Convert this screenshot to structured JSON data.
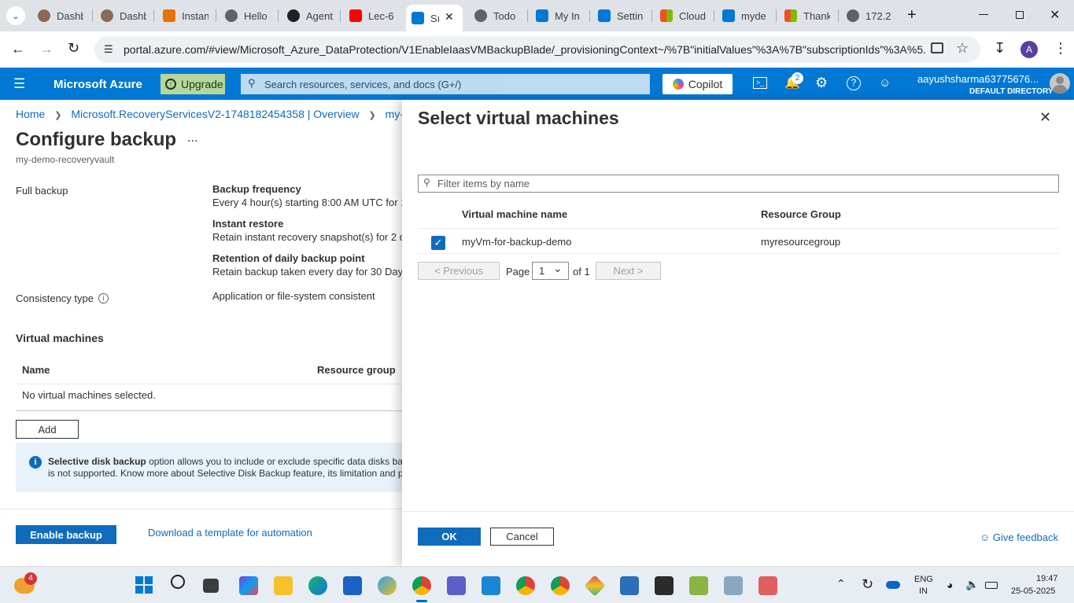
{
  "browser": {
    "tabs": [
      {
        "label": "Dashb",
        "favicon_color": "#8a6a55"
      },
      {
        "label": "Dashb",
        "favicon_color": "#8a6a55"
      },
      {
        "label": "Instan",
        "favicon_color": "#e8710a"
      },
      {
        "label": "Hello",
        "favicon_color": "#5f6368"
      },
      {
        "label": "Agent",
        "favicon_color": "#202124"
      },
      {
        "label": "Lec-6",
        "favicon_color": "#ff0000"
      },
      {
        "label": "Sı",
        "favicon_color": "#0078d4"
      },
      {
        "label": "Todo",
        "favicon_color": "#5f6368"
      },
      {
        "label": "My In",
        "favicon_color": "#0078d4"
      },
      {
        "label": "Settin",
        "favicon_color": "#0078d4"
      },
      {
        "label": "Cloud",
        "favicon_color": "#f25022"
      },
      {
        "label": "myde",
        "favicon_color": "#0078d4"
      },
      {
        "label": "Thank",
        "favicon_color": "#f25022"
      },
      {
        "label": "172.2",
        "favicon_color": "#5f6368"
      }
    ],
    "url": "portal.azure.com/#view/Microsoft_Azure_DataProtection/V1EnableIaasVMBackupBlade/_provisioningContext~/%7B\"initialValues\"%3A%7B\"subscriptionIds\"%3A%5...",
    "profile_initial": "A"
  },
  "azure": {
    "brand": "Microsoft Azure",
    "upgrade_label": "Upgrade",
    "search_placeholder": "Search resources, services, and docs (G+/)",
    "copilot_label": "Copilot",
    "notification_count": "2",
    "user_name": "aayushsharma63775676...",
    "directory": "DEFAULT DIRECTORY",
    "accent": "#0078d4"
  },
  "breadcrumb": {
    "home": "Home",
    "vault": "Microsoft.RecoveryServicesV2-1748182454358 | Overview",
    "current": "my-demo"
  },
  "config": {
    "title": "Configure backup",
    "more": "...",
    "subtitle": "my-demo-recoveryvault",
    "full_backup_label": "Full backup",
    "backup_frequency_heading": "Backup frequency",
    "backup_frequency_text": "Every 4 hour(s) starting 8:00 AM UTC for 1",
    "instant_restore_heading": "Instant restore",
    "instant_restore_text": "Retain instant recovery snapshot(s) for 2 d",
    "retention_heading": "Retention of daily backup point",
    "retention_text": "Retain backup taken every day for 30 Day(",
    "consistency_label": "Consistency type",
    "consistency_value": "Application or file-system consistent",
    "vm_section_title": "Virtual machines",
    "col_name": "Name",
    "col_rg": "Resource group",
    "empty_text": "No virtual machines selected.",
    "add_label": "Add",
    "info_bold": "Selective disk backup",
    "info_line1": " option allows you to include or exclude specific data disks bas",
    "info_line2": "is not supported. Know more about Selective Disk Backup feature, its limitation and p",
    "enable_label": "Enable backup",
    "template_link": "Download a template for automation"
  },
  "panel": {
    "title": "Select virtual machines",
    "filter_placeholder": "Filter items by name",
    "col_vm": "Virtual machine name",
    "col_rg": "Resource Group",
    "rows": [
      {
        "name": "myVm-for-backup-demo",
        "rg": "myresourcegroup",
        "checked": true
      }
    ],
    "prev_label": "< Previous",
    "page_label": "Page",
    "page_value": "1",
    "of_label": "of 1",
    "next_label": "Next >",
    "ok_label": "OK",
    "cancel_label": "Cancel",
    "feedback_label": "Give feedback"
  },
  "taskbar": {
    "badge": "4",
    "lang1": "ENG",
    "lang2": "IN",
    "time": "19:47",
    "date": "25-05-2025"
  }
}
